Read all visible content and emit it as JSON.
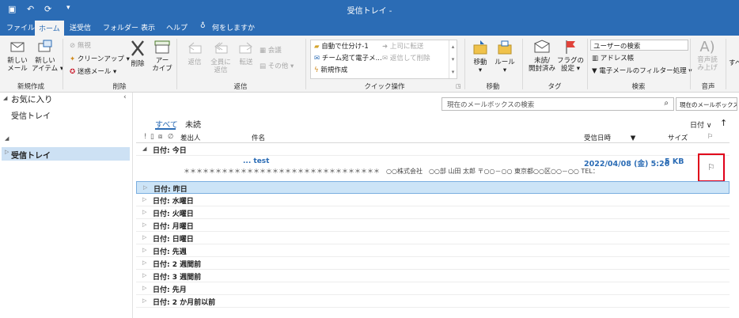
{
  "window": {
    "title": "受信トレイ -"
  },
  "menu_tabs": [
    "ファイル",
    "ホーム",
    "送受信",
    "フォルダー",
    "表示",
    "ヘルプ"
  ],
  "tell_me": "何をしますか",
  "ribbon": {
    "new": {
      "new_mail": [
        "新しい",
        "メール"
      ],
      "new_item": [
        "新しい",
        "アイテム"
      ],
      "group": "新規作成"
    },
    "delete": {
      "ignore": "無視",
      "cleanup": "クリーンアップ",
      "junk": "迷惑メール",
      "delete": "削除",
      "archive": [
        "アー",
        "カイブ"
      ],
      "group": "削除"
    },
    "respond": {
      "reply": "返信",
      "reply_all": [
        "全員に",
        "返信"
      ],
      "forward": "転送",
      "meeting": "会議",
      "more": "その他",
      "group": "返信"
    },
    "quick_steps": {
      "items": [
        "自動で仕分け-1",
        "上司に転送",
        "チーム宛て電子メ...",
        "返信して削除",
        "新規作成"
      ],
      "group": "クイック操作"
    },
    "move": {
      "move": "移動",
      "rules": "ルール",
      "group": "移動"
    },
    "tags": {
      "unread": [
        "未読/",
        "開封済み"
      ],
      "flag": [
        "フラグの",
        "設定"
      ],
      "group": "タグ"
    },
    "find": {
      "search_people": "ユーザーの検索",
      "address_book": "アドレス帳",
      "filter": "電子メールのフィルター処理",
      "group": "検索"
    },
    "speech": {
      "read_aloud": [
        "音声読",
        "み上げ"
      ],
      "group": "音声"
    },
    "extra": "すべ"
  },
  "nav": {
    "favorites": "お気に入り",
    "fav_inbox": "受信トレイ",
    "inbox": "受信トレイ"
  },
  "search": {
    "placeholder": "現在のメールボックスの検索",
    "scope": "現在のメールボックス"
  },
  "filters": {
    "all": "すべて",
    "unread": "未読",
    "sort": "日付"
  },
  "columns": {
    "from": "差出人",
    "subject": "件名",
    "received": "受信日時",
    "size": "サイズ"
  },
  "groups": {
    "today": "日付: 今日",
    "others": [
      "日付: 昨日",
      "日付: 水曜日",
      "日付: 火曜日",
      "日付: 月曜日",
      "日付: 日曜日",
      "日付: 先週",
      "日付: 2 週間前",
      "日付: 3 週間前",
      "日付: 先月",
      "日付: 2 か月前以前"
    ]
  },
  "message": {
    "subject": "... test",
    "date": "2022/04/08 (金) 5:26",
    "size": "5 KB",
    "preview": "＊＊＊＊＊＊＊＊＊＊＊＊＊＊＊＊＊＊＊＊＊＊＊＊＊＊＊＊＊＊＊　○○株式会社　○○部 山田 太郎 〒○○－○○ 東京都○○区○○－○○ TEL："
  },
  "colors": {
    "accent": "#2b6cb5",
    "selected_row": "#cce4f7",
    "highlight_box": "#e0001a"
  }
}
